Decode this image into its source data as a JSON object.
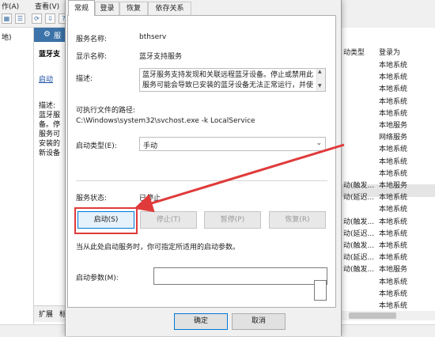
{
  "background": {
    "menubar": {
      "item_partial": "作(A)",
      "item_view": "查看(V)"
    },
    "tree": {
      "label": "地)"
    },
    "description_pane": {
      "header_text": "服",
      "service_title": "蓝牙支",
      "start_link": "启动",
      "description_label": "描述:",
      "description_lines": [
        "蓝牙服",
        "备。停",
        "服务可",
        "安装的",
        "新设备"
      ]
    },
    "bottom_tabs": {
      "extended": "扩展",
      "standard": "标"
    },
    "list": {
      "headers": [
        "动类型",
        "登录为"
      ],
      "rows": [
        {
          "c1": "",
          "c2": "本地系统"
        },
        {
          "c1": "",
          "c2": "本地系统"
        },
        {
          "c1": "",
          "c2": "本地系统"
        },
        {
          "c1": "",
          "c2": "本地系统"
        },
        {
          "c1": "",
          "c2": "本地系统"
        },
        {
          "c1": "",
          "c2": "本地服务"
        },
        {
          "c1": "",
          "c2": "网络服务"
        },
        {
          "c1": "",
          "c2": "本地系统"
        },
        {
          "c1": "",
          "c2": "本地系统"
        },
        {
          "c1": "",
          "c2": "本地系统"
        },
        {
          "c1": "动(触发...",
          "c2": "本地服务"
        },
        {
          "c1": "动(延迟...",
          "c2": "本地系统"
        },
        {
          "c1": "",
          "c2": "本地系统"
        },
        {
          "c1": "动(触发...",
          "c2": "本地系统"
        },
        {
          "c1": "动(延迟...",
          "c2": "本地系统"
        },
        {
          "c1": "动(触发...",
          "c2": "本地系统"
        },
        {
          "c1": "动(延迟...",
          "c2": "本地系统"
        },
        {
          "c1": "动(触发...",
          "c2": "本地服务"
        },
        {
          "c1": "",
          "c2": "本地系统"
        },
        {
          "c1": "",
          "c2": "本地系统"
        },
        {
          "c1": "",
          "c2": "本地系统"
        }
      ]
    }
  },
  "dialog": {
    "tabs": [
      "常规",
      "登录",
      "恢复",
      "依存关系"
    ],
    "active_tab": "常规",
    "service_name_label": "服务名称:",
    "service_name": "bthserv",
    "display_name_label": "显示名称:",
    "display_name": "蓝牙支持服务",
    "description_label": "描述:",
    "description_lines": [
      "蓝牙服务支持发现和关联远程蓝牙设备。停止或禁用此",
      "服务可能会导致已安装的蓝牙设备无法正常运行，并使"
    ],
    "exe_path_label": "可执行文件的路径:",
    "exe_path": "C:\\Windows\\system32\\svchost.exe -k LocalService",
    "startup_type_label": "启动类型(E):",
    "startup_type": "手动",
    "service_status_label": "服务状态:",
    "service_status": "已停止",
    "buttons": {
      "start": "启动(S)",
      "stop": "停止(T)",
      "pause": "暂停(P)",
      "resume": "恢复(R)"
    },
    "hint": "当从此处启动服务时，你可指定所适用的启动参数。",
    "start_params_label": "启动参数(M):",
    "start_params_value": "",
    "ok": "确定",
    "cancel": "取消"
  },
  "colors": {
    "annotation_red": "#e03a3a",
    "accent_blue": "#0078d7",
    "header_blue": "#3c73a8"
  }
}
